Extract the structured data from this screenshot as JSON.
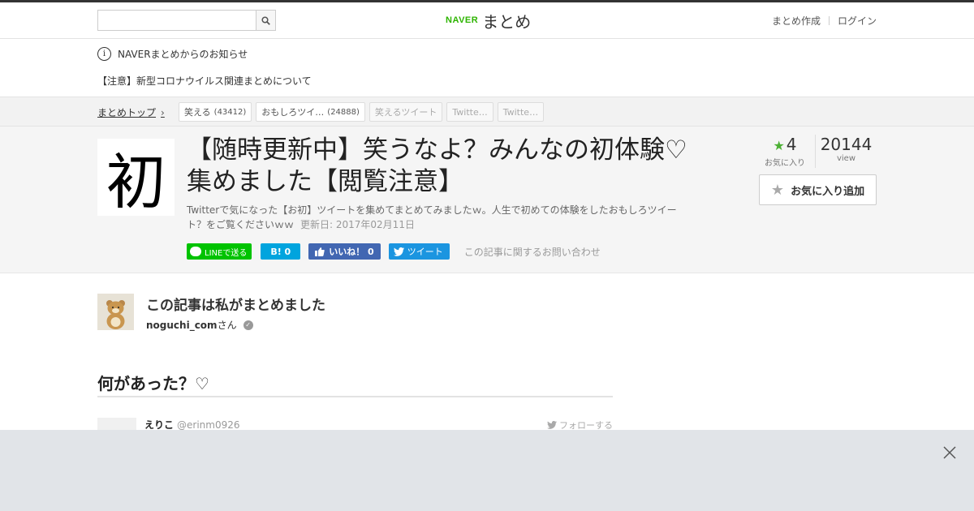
{
  "header": {
    "search": {
      "placeholder": "",
      "value": ""
    },
    "logo_naver": "NAVER",
    "logo_matome": "まとめ",
    "links": [
      "まとめ作成",
      "ログイン"
    ]
  },
  "notice": {
    "heading": "NAVERまとめからのお知らせ",
    "item": "【注意】新型コロナウイルス関連まとめについて"
  },
  "breadcrumb": {
    "top": "まとめトップ",
    "tags": [
      {
        "label": "笑える",
        "count": "(43412)"
      },
      {
        "label": "おもしろツイ…",
        "count": "(24888)"
      },
      {
        "label": "笑えるツイート",
        "count": ""
      },
      {
        "label": "Twitte…",
        "count": ""
      },
      {
        "label": "Twitte…",
        "count": ""
      }
    ]
  },
  "article": {
    "thumb_char": "初",
    "title": "【随時更新中】笑うなよ？みんなの初体験♡集めました【閲覧注意】",
    "description": "Twitterで気になった【お初】ツイートを集めてまとめてみましたｗ。人生で初めての体験をしたおもしろツイート？をご覧くださいｗｗ",
    "updated": "更新日: 2017年02月11日",
    "share": {
      "line": "LINEで送る",
      "hatena": "B! 0",
      "facebook": "いいね！ 0",
      "twitter": "ツイート",
      "contact": "この記事に関するお問い合わせ"
    },
    "stats": {
      "favorites": "4",
      "favorites_label": "お気に入り",
      "views": "20144",
      "views_label": "view"
    },
    "fav_button": "お気に入り追加"
  },
  "curator": {
    "title": "この記事は私がまとめました",
    "name": "noguchi_com",
    "suffix": "さん"
  },
  "section": {
    "heading": "何があった？♡"
  },
  "tweet": {
    "name": "えりこ",
    "handle": "@erinm0926",
    "follow": "フォローする"
  },
  "colors": {
    "naver_green": "#2db400",
    "line_green": "#00c300",
    "hatena_blue": "#00a4de",
    "facebook_blue": "#4267b2",
    "twitter_blue": "#1b95e0"
  }
}
